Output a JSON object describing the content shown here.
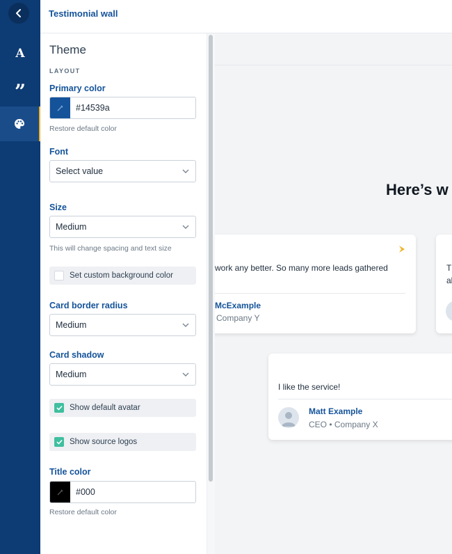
{
  "app": {
    "title": "Testimonial wall"
  },
  "rail": {
    "items": [
      {
        "name": "back",
        "icon": "chevron-left-icon"
      },
      {
        "name": "text",
        "icon": "letter-a-icon",
        "glyph": "A"
      },
      {
        "name": "testimonials",
        "icon": "quote-icon",
        "glyph": "”"
      },
      {
        "name": "theme",
        "icon": "palette-icon",
        "active": true
      }
    ]
  },
  "panel": {
    "title": "Theme",
    "section": "LAYOUT",
    "primary_color": {
      "label": "Primary color",
      "value": "#14539a",
      "restore": "Restore default color",
      "swatch": "#14539a"
    },
    "font": {
      "label": "Font",
      "placeholder": "Select value"
    },
    "size": {
      "label": "Size",
      "value": "Medium",
      "hint": "This will change spacing and text size"
    },
    "custom_bg": {
      "label": "Set custom background color",
      "checked": false
    },
    "card_radius": {
      "label": "Card border radius",
      "value": "Medium"
    },
    "card_shadow": {
      "label": "Card shadow",
      "value": "Medium"
    },
    "default_avatar": {
      "label": "Show default avatar",
      "checked": true
    },
    "source_logos": {
      "label": "Show source logos",
      "checked": true
    },
    "title_color": {
      "label": "Title color",
      "value": "#000",
      "restore": "Restore default color",
      "swatch": "#000000"
    }
  },
  "preview": {
    "heading": "Here’s w",
    "cards": [
      {
        "quote": "work any better. So many more leads gathered",
        "name": "McExample",
        "role": "Company Y"
      },
      {
        "quote_line1": "T",
        "quote_line2": "al"
      },
      {
        "quote": "I like the service!",
        "name": "Matt Example",
        "role": "CEO • Company X"
      }
    ]
  },
  "colors": {
    "accent": "#14539a",
    "rail": "#0d3b73",
    "check": "#3fbf9f",
    "source_mark": "#f0b429"
  }
}
